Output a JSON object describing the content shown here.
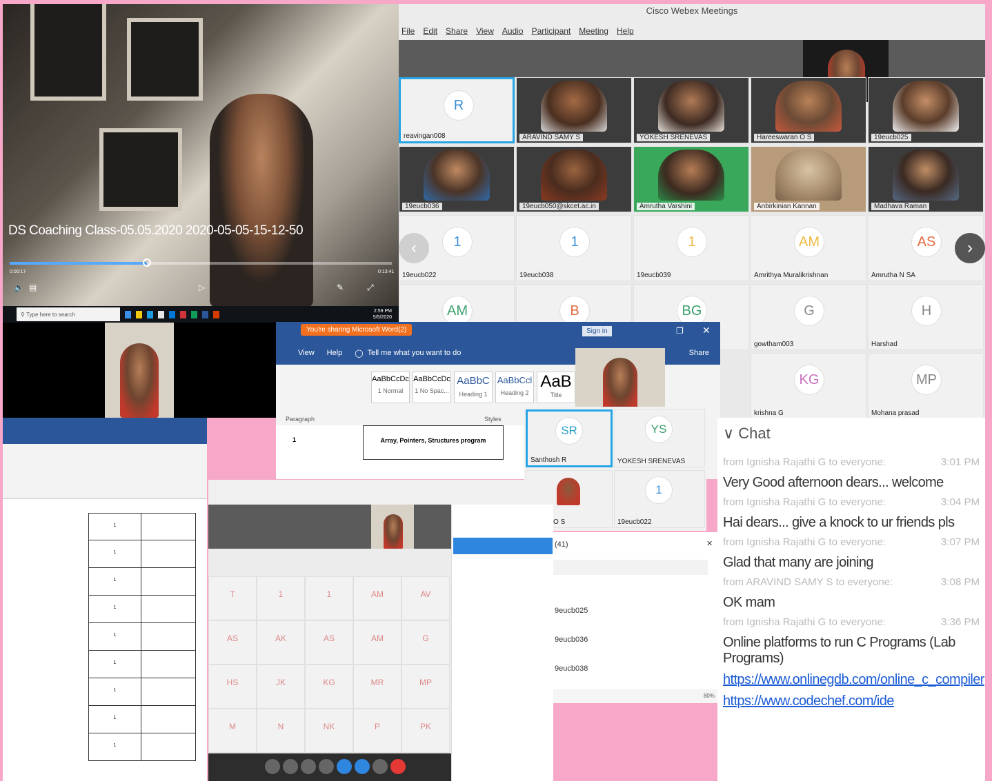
{
  "video_player": {
    "title": "DS Coaching Class-05.05.2020 2020-05-05-15-12-50",
    "progress": 0.36,
    "time_left": "0:00:17",
    "time_right": "0:13:41"
  },
  "taskbar": {
    "search_placeholder": "Type here to search",
    "clock_time": "2:59 PM",
    "clock_date": "5/5/2020"
  },
  "webex": {
    "title": "Cisco Webex Meetings",
    "menu": [
      "File",
      "Edit",
      "Share",
      "View",
      "Audio",
      "Participant",
      "Meeting",
      "Help"
    ],
    "video_tiles": [
      {
        "name": "reavingan008",
        "avatar": "R"
      },
      {
        "name": "ARAVIND SAMY S"
      },
      {
        "name": "YOKESH SRENEVAS"
      },
      {
        "name": "Hareeswaran O S"
      },
      {
        "name": "19eucb025"
      },
      {
        "name": "19eucb036"
      },
      {
        "name": "19eucb050@skcet.ac.in"
      },
      {
        "name": "Amrutha Varshini"
      },
      {
        "name": "Anbirkinian Kannan"
      },
      {
        "name": "Madhava Raman"
      }
    ],
    "avatar_tiles": [
      {
        "initials": "1",
        "name": "19eucb022"
      },
      {
        "initials": "1",
        "name": "19eucb038"
      },
      {
        "initials": "1",
        "name": "19eucb039"
      },
      {
        "initials": "AM",
        "name": "Amrithya Muralikrishnan"
      },
      {
        "initials": "AS",
        "name": "Amrutha N SA"
      },
      {
        "initials": "AM",
        "name": ""
      },
      {
        "initials": "B",
        "name": ""
      },
      {
        "initials": "BG",
        "name": ""
      },
      {
        "initials": "G",
        "name": "gowtham003"
      },
      {
        "initials": "H",
        "name": "Harshad"
      },
      {
        "initials": "KG",
        "name": "krishna G"
      },
      {
        "initials": "MP",
        "name": "Mohana prasad"
      }
    ]
  },
  "chat": {
    "header": "Chat",
    "messages": [
      {
        "from": "from Ignisha Rajathi G to everyone:",
        "time": "3:01 PM",
        "text": "Very Good afternoon dears... welcome"
      },
      {
        "from": "from Ignisha Rajathi G to everyone:",
        "time": "3:04 PM",
        "text": "Hai dears... give a knock to ur friends pls"
      },
      {
        "from": "from Ignisha Rajathi G to everyone:",
        "time": "3:07 PM",
        "text": "Glad that many are joining"
      },
      {
        "from": "from ARAVIND SAMY S to everyone:",
        "time": "3:08 PM",
        "text": "OK mam"
      },
      {
        "from": "from Ignisha Rajathi G to everyone:",
        "time": "3:36 PM",
        "text": "Online platforms to run C Programs (Lab Programs)"
      }
    ],
    "links": [
      "https://www.onlinegdb.com/online_c_compiler",
      "https://www.codechef.com/ide"
    ]
  },
  "word_top": {
    "sharing_banner": "You're sharing Microsoft Word(2)",
    "sign_in": "Sign in",
    "tabs": [
      "View",
      "Help"
    ],
    "tell_me": "Tell me what you want to do",
    "share": "Share",
    "styles": [
      {
        "sample": "AaBbCcDc",
        "name": "1 Normal"
      },
      {
        "sample": "AaBbCcDc",
        "name": "1 No Spac..."
      },
      {
        "sample": "AaBbC",
        "name": "Heading 1"
      },
      {
        "sample": "AaBbCcl",
        "name": "Heading 2"
      },
      {
        "sample": "AaB",
        "name": "Title"
      }
    ],
    "paragraph_label": "Paragraph",
    "styles_label": "Styles",
    "table_row_num": "1",
    "table_row_text": "Array, Pointers, Structures program"
  },
  "parts2": {
    "tiles": [
      {
        "initials": "SR",
        "name": "Santhosh R"
      },
      {
        "initials": "YS",
        "name": "YOKESH SRENEVAS"
      },
      {
        "initials": "",
        "name": "swaran O S"
      },
      {
        "initials": "1",
        "name": "19eucb022"
      }
    ]
  },
  "list_panel": {
    "count": "(41)",
    "rows": [
      "9eucb025",
      "9eucb036",
      "9eucb038"
    ]
  },
  "zoom_level": "80%"
}
